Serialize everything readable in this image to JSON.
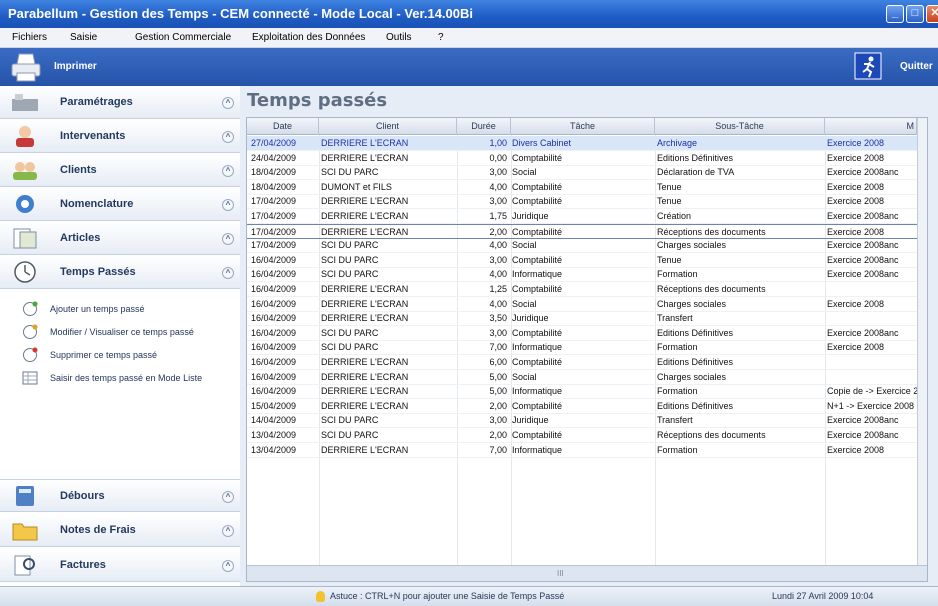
{
  "window": {
    "title": "Parabellum - Gestion des Temps - CEM connecté - Mode Local - Ver.14.00Bi"
  },
  "menu": [
    "Fichiers",
    "Saisie",
    "Gestion Commerciale",
    "Exploitation des Données",
    "Outils",
    "?"
  ],
  "toolbar": {
    "print_label": "Imprimer",
    "quit_label": "Quitter"
  },
  "sidebar": {
    "sections": [
      "Paramétrages",
      "Intervenants",
      "Clients",
      "Nomenclature",
      "Articles",
      "Temps Passés"
    ],
    "actions": [
      "Ajouter un temps passé",
      "Modifier / Visualiser ce temps passé",
      "Supprimer ce temps passé",
      "Saisir des temps passé en Mode Liste"
    ],
    "bottom_sections": [
      "Débours",
      "Notes de Frais",
      "Factures"
    ]
  },
  "main": {
    "title": "Temps passés"
  },
  "grid": {
    "columns": [
      "Date",
      "Client",
      "Durée",
      "Tâche",
      "Sous-Tâche",
      "M"
    ],
    "rows": [
      [
        "27/04/2009",
        "DERRIERE L'ECRAN",
        "1,00",
        "Divers Cabinet",
        "Archivage",
        "Exercice 2008"
      ],
      [
        "24/04/2009",
        "DERRIERE L'ECRAN",
        "0,00",
        "Comptabilité",
        "Editions Définitives",
        "Exercice 2008"
      ],
      [
        "18/04/2009",
        "SCI DU PARC",
        "3,00",
        "Social",
        "Déclaration de TVA",
        "Exercice 2008anc"
      ],
      [
        "18/04/2009",
        "DUMONT et FILS",
        "4,00",
        "Comptabilité",
        "Tenue",
        "Exercice 2008"
      ],
      [
        "17/04/2009",
        "DERRIERE L'ECRAN",
        "3,00",
        "Comptabilité",
        "Tenue",
        "Exercice 2008"
      ],
      [
        "17/04/2009",
        "DERRIERE L'ECRAN",
        "1,75",
        "Juridique",
        "Création",
        "Exercice 2008anc"
      ],
      [
        "17/04/2009",
        "DERRIERE L'ECRAN",
        "2,00",
        "Comptabilité",
        "Réceptions des documents",
        "Exercice 2008"
      ],
      [
        "17/04/2009",
        "SCI DU PARC",
        "4,00",
        "Social",
        "Charges sociales",
        "Exercice 2008anc"
      ],
      [
        "16/04/2009",
        "SCI DU PARC",
        "3,00",
        "Comptabilité",
        "Tenue",
        "Exercice 2008anc"
      ],
      [
        "16/04/2009",
        "SCI DU PARC",
        "4,00",
        "Informatique",
        "Formation",
        "Exercice 2008anc"
      ],
      [
        "16/04/2009",
        "DERRIERE L'ECRAN",
        "1,25",
        "Comptabilité",
        "Réceptions des documents",
        ""
      ],
      [
        "16/04/2009",
        "DERRIERE L'ECRAN",
        "4,00",
        "Social",
        "Charges sociales",
        "Exercice 2008"
      ],
      [
        "16/04/2009",
        "DERRIERE L'ECRAN",
        "3,50",
        "Juridique",
        "Transfert",
        ""
      ],
      [
        "16/04/2009",
        "SCI DU PARC",
        "3,00",
        "Comptabilité",
        "Editions Définitives",
        "Exercice 2008anc"
      ],
      [
        "16/04/2009",
        "SCI DU PARC",
        "7,00",
        "Informatique",
        "Formation",
        "Exercice 2008"
      ],
      [
        "16/04/2009",
        "DERRIERE L'ECRAN",
        "6,00",
        "Comptabilité",
        "Editions Définitives",
        ""
      ],
      [
        "16/04/2009",
        "DERRIERE L'ECRAN",
        "5,00",
        "Social",
        "Charges sociales",
        ""
      ],
      [
        "16/04/2009",
        "DERRIERE L'ECRAN",
        "5,00",
        "Informatique",
        "Formation",
        "Copie de -> Exercice 2"
      ],
      [
        "15/04/2009",
        "DERRIERE L'ECRAN",
        "2,00",
        "Comptabilité",
        "Editions Définitives",
        "N+1 -> Exercice 2008"
      ],
      [
        "14/04/2009",
        "SCI DU PARC",
        "3,00",
        "Juridique",
        "Transfert",
        "Exercice 2008anc"
      ],
      [
        "13/04/2009",
        "SCI DU PARC",
        "2,00",
        "Comptabilité",
        "Réceptions des documents",
        "Exercice 2008anc"
      ],
      [
        "13/04/2009",
        "DERRIERE L'ECRAN",
        "7,00",
        "Informatique",
        "Formation",
        "Exercice 2008"
      ]
    ],
    "scroll_mark": "III"
  },
  "status": {
    "tip": "Astuce : CTRL+N pour ajouter une Saisie de Temps Passé",
    "datetime": "Lundi 27 Avril 2009 10:04"
  },
  "colors": {
    "selected_text": "#1b2fa6",
    "bold_text": "#111111",
    "titlebar": "#1f5cc4"
  }
}
